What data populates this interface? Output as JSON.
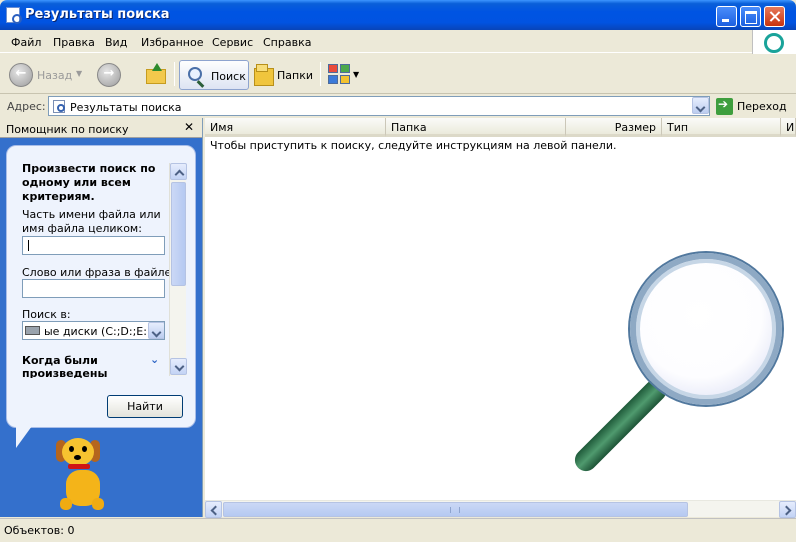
{
  "window": {
    "title": "Результаты поиска"
  },
  "menu": {
    "items": [
      "Файл",
      "Правка",
      "Вид",
      "Избранное",
      "Сервис",
      "Справка"
    ]
  },
  "toolbar": {
    "back_label": "Назад",
    "search_label": "Поиск",
    "folders_label": "Папки",
    "icons": [
      "back-icon",
      "forward-icon",
      "up-folder-icon",
      "search-icon",
      "folders-icon",
      "views-icon"
    ]
  },
  "address": {
    "label": "Адрес:",
    "value": "Результаты поиска",
    "go_label": "Переход"
  },
  "search_panel": {
    "title": "Помощник по поиску",
    "heading": "Произвести поиск по одному или всем критериям.",
    "filename_label": "Часть имени файла или имя файла целиком:",
    "filename_value": "",
    "phrase_label": "Слово или фраза в файле:",
    "phrase_value": "",
    "look_in_label": "Поиск в:",
    "look_in_value": "ые диски (C:;D:;E:)",
    "when_label": "Когда были произведены",
    "find_button": "Найти"
  },
  "results": {
    "columns": [
      "Имя",
      "Папка",
      "Размер",
      "Тип",
      "И"
    ],
    "empty_message": "Чтобы приступить к поиску, следуйте инструкциям на левой панели."
  },
  "status": {
    "text": "Объектов: 0"
  },
  "colors": {
    "titlebar": "#0054e3",
    "panel_blue": "#3470cc",
    "chrome": "#ece9d8"
  }
}
